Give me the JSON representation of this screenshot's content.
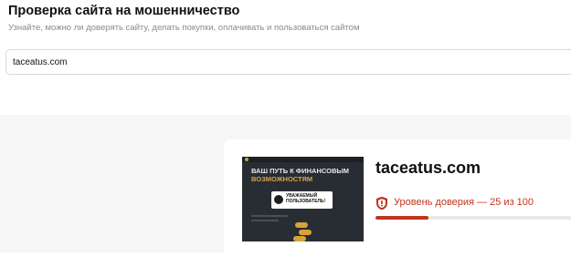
{
  "header": {
    "title": "Проверка сайта на мошенничество",
    "subtitle": "Узнайте, можно ли доверять сайту, делать покупки, оплачивать и пользоваться сайтом"
  },
  "search": {
    "value": "taceatus.com"
  },
  "result": {
    "domain": "taceatus.com",
    "trust_label": "Уровень доверия — 25 из 100",
    "trust_score": 25,
    "trust_max": 100,
    "icon": "shield-warning-icon",
    "colors": {
      "warning": "#c0341d",
      "track": "#e9e9e9"
    },
    "screenshot": {
      "heading_line1": "ВАШ ПУТЬ К ФИНАНСОВЫМ",
      "heading_line2": "ВОЗМОЖНОСТЯМ",
      "popup_text": "УВАЖАЕМЫЙ ПОЛЬЗОВАТЕЛЬ!"
    }
  }
}
